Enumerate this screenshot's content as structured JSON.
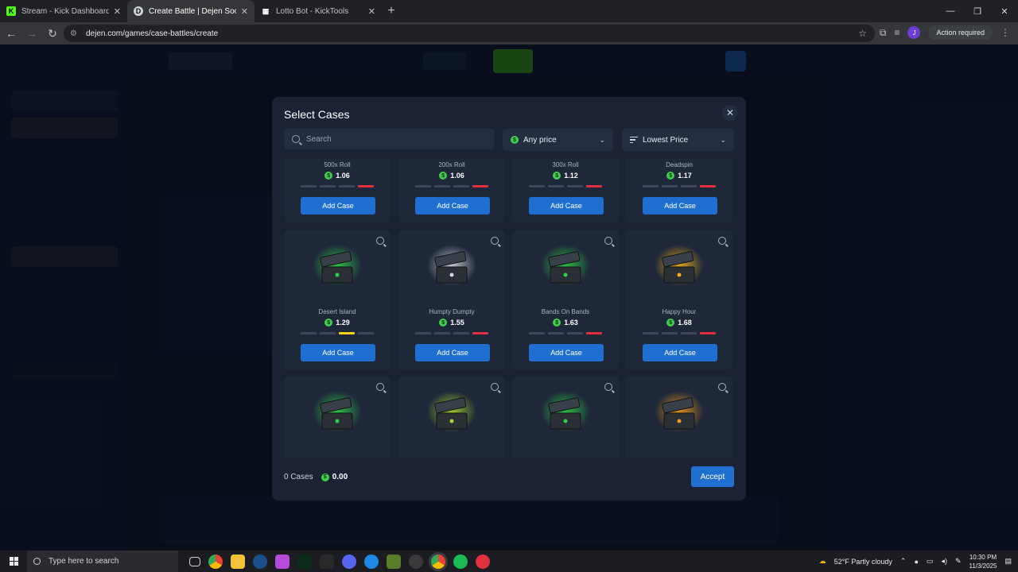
{
  "browser": {
    "tabs": [
      {
        "title": "Stream - Kick Dashboard",
        "favicon": "K",
        "favicon_color": "#53fc18",
        "active": false
      },
      {
        "title": "Create Battle | Dejen Social Cas",
        "favicon": "D",
        "favicon_color": "#e6e9f0",
        "active": true
      },
      {
        "title": "Lotto Bot - KickTools",
        "favicon": "▦",
        "favicon_color": "#ffffff",
        "active": false
      }
    ],
    "new_tab": "+",
    "url": "dejen.com/games/case-battles/create",
    "profile_initial": "J",
    "action_required": "Action required"
  },
  "modal": {
    "title": "Select Cases",
    "search_placeholder": "Search",
    "price_filter": "Any price",
    "sort": "Lowest Price",
    "add_label": "Add Case",
    "cases": [
      {
        "name": "500x Roll",
        "price": "1.06",
        "meter_level": 0.95,
        "meter_color": "#e0303e"
      },
      {
        "name": "200x Roll",
        "price": "1.06",
        "meter_level": 0.95,
        "meter_color": "#e0303e"
      },
      {
        "name": "300x Roll",
        "price": "1.12",
        "meter_level": 0.95,
        "meter_color": "#e0303e"
      },
      {
        "name": "Deadspin",
        "price": "1.17",
        "meter_level": 0.95,
        "meter_color": "#e0303e"
      },
      {
        "name": "Desert Island",
        "price": "1.29",
        "meter_level": 0.7,
        "meter_color": "#f2d21b",
        "image_icon": "treasure-chest-house-icon",
        "glow": "#2bd14a"
      },
      {
        "name": "Humpty Dumpty",
        "price": "1.55",
        "meter_level": 0.85,
        "meter_color": "#e0303e",
        "image_icon": "egg-chest-icon",
        "glow": "#cfd6e0"
      },
      {
        "name": "Bands On Bands",
        "price": "1.63",
        "meter_level": 0.95,
        "meter_color": "#e0303e",
        "image_icon": "money-roll-chest-icon",
        "glow": "#2bd14a"
      },
      {
        "name": "Happy Hour",
        "price": "1.68",
        "meter_level": 0.9,
        "meter_color": "#e0303e",
        "image_icon": "cocktail-chest-icon",
        "glow": "#f2b21b"
      },
      {
        "name": "",
        "price": "",
        "image_icon": "bottle-chest-icon",
        "glow": "#2bd14a"
      },
      {
        "name": "",
        "price": "",
        "image_icon": "champagne-chest-icon",
        "glow": "#a8d62b"
      },
      {
        "name": "",
        "price": "",
        "image_icon": "globe-chest-icon",
        "glow": "#2bd14a"
      },
      {
        "name": "",
        "price": "",
        "image_icon": "gold-chest-icon",
        "glow": "#f29a1b"
      }
    ],
    "footer": {
      "cases_count": "0 Cases",
      "total": "0.00",
      "accept": "Accept"
    }
  },
  "taskbar": {
    "search_placeholder": "Type here to search",
    "weather": "52°F  Partly cloudy",
    "time": "10:30 PM",
    "date": "11/3/2025"
  }
}
